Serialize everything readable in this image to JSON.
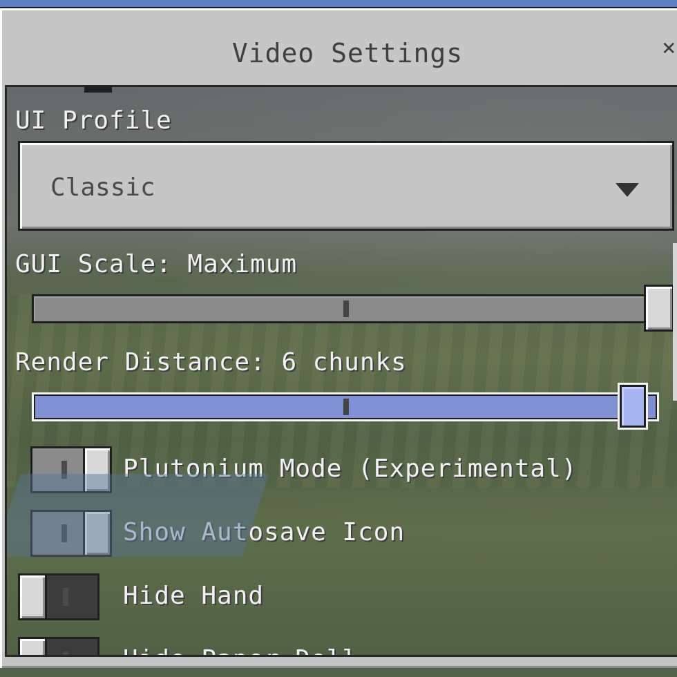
{
  "window": {
    "title": "Video Settings",
    "close_icon": "×"
  },
  "settings": {
    "ui_profile": {
      "label": "UI Profile",
      "value": "Classic"
    },
    "gui_scale": {
      "label": "GUI Scale: Maximum",
      "position": 1.0
    },
    "render_distance": {
      "label": "Render Distance: 6 chunks",
      "position": 0.97
    },
    "toggles": [
      {
        "label": "Plutonium Mode (Experimental)",
        "enabled": true
      },
      {
        "label": "Show Autosave Icon",
        "enabled": true
      },
      {
        "label": "Hide Hand",
        "enabled": false
      },
      {
        "label": "Hide Paper Doll",
        "enabled": false
      }
    ]
  }
}
